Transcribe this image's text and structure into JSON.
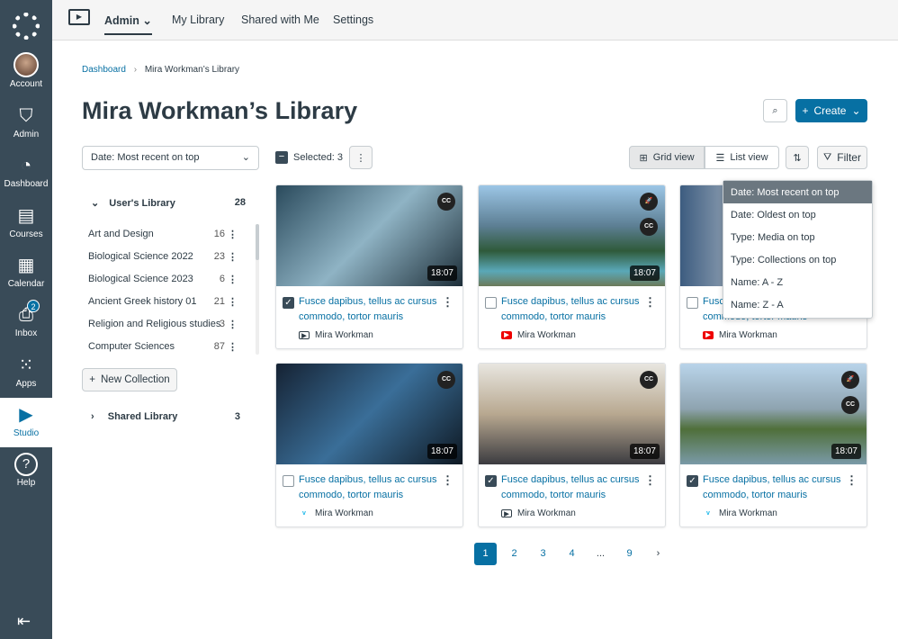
{
  "sidebar": {
    "items": [
      {
        "label": "Account"
      },
      {
        "label": "Admin"
      },
      {
        "label": "Dashboard"
      },
      {
        "label": "Courses"
      },
      {
        "label": "Calendar"
      },
      {
        "label": "Inbox",
        "badge": "2"
      },
      {
        "label": "Apps"
      },
      {
        "label": "Studio",
        "active": true
      },
      {
        "label": "Help"
      }
    ]
  },
  "topnav": {
    "items": [
      "Admin",
      "My Library",
      "Shared with Me",
      "Settings"
    ]
  },
  "breadcrumb": {
    "root": "Dashboard",
    "current": "Mira Workman’s Library"
  },
  "page_title": "Mira Workman’s Library",
  "create_label": "Create",
  "sort_select": "Date: Most recent on top",
  "selected_label": "Selected: 3",
  "views": {
    "grid": "Grid view",
    "list": "List view",
    "filter": "Filter"
  },
  "sort_menu": [
    "Date: Most recent on top",
    "Date: Oldest on top",
    "Type: Media on top",
    "Type: Collections on top",
    "Name: A - Z",
    "Name: Z - A"
  ],
  "users_library": {
    "label": "User's Library",
    "count": "28",
    "collections": [
      {
        "name": "Art and Design",
        "count": "16"
      },
      {
        "name": "Biological Science 2022",
        "count": "23"
      },
      {
        "name": "Biological Science 2023",
        "count": "6"
      },
      {
        "name": "Ancient Greek history 01",
        "count": "21"
      },
      {
        "name": "Religion and Religious studies",
        "count": "3"
      },
      {
        "name": "Computer Sciences",
        "count": "87"
      }
    ]
  },
  "new_collection": "New Collection",
  "shared_library": {
    "label": "Shared Library",
    "count": "3"
  },
  "cards": [
    {
      "title": "Fusce dapibus, tellus ac cursus commodo, tortor mauris",
      "author": "Mira Workman",
      "duration": "18:07",
      "checked": true,
      "source": "studio",
      "cc": true,
      "rocket": false
    },
    {
      "title": "Fusce dapibus, tellus ac cursus commodo, tortor mauris",
      "author": "Mira Workman",
      "duration": "18:07",
      "checked": false,
      "source": "youtube",
      "cc": true,
      "rocket": true
    },
    {
      "title": "Fusce dapibus, tellus ac cursus commodo, tortor mauris",
      "author": "Mira Workman",
      "duration": "18:07",
      "checked": false,
      "source": "youtube",
      "cc": false,
      "rocket": false
    },
    {
      "title": "Fusce dapibus, tellus ac cursus commodo, tortor mauris",
      "author": "Mira Workman",
      "duration": "18:07",
      "checked": false,
      "source": "vimeo",
      "cc": true,
      "rocket": false
    },
    {
      "title": "Fusce dapibus, tellus ac cursus commodo, tortor mauris",
      "author": "Mira Workman",
      "duration": "18:07",
      "checked": true,
      "source": "studio",
      "cc": true,
      "rocket": false
    },
    {
      "title": "Fusce dapibus, tellus ac cursus commodo, tortor mauris",
      "author": "Mira Workman",
      "duration": "18:07",
      "checked": true,
      "source": "vimeo",
      "cc": true,
      "rocket": true
    }
  ],
  "pagination": {
    "pages": [
      "1",
      "2",
      "3",
      "4",
      "...",
      "9"
    ],
    "current": "1"
  },
  "colors": {
    "sidebar": "#394b58",
    "accent": "#0770a3"
  }
}
